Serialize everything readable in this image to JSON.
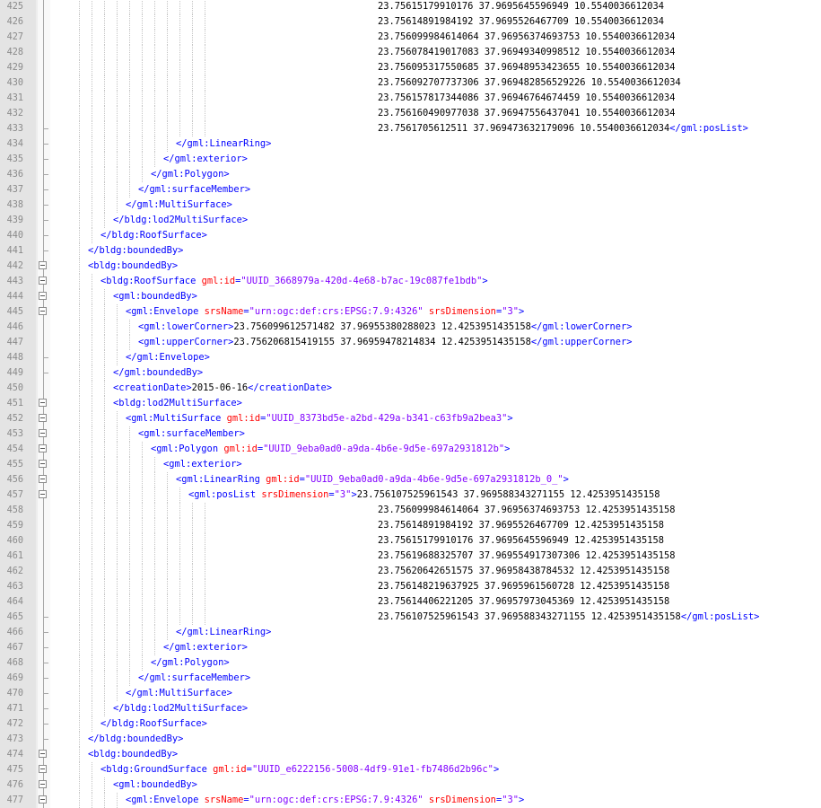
{
  "editor": {
    "colors": {
      "tag": "#0000ff",
      "attribute": "#ff0000",
      "value": "#8000ff",
      "text": "#000000",
      "gutter": "#e4e4e4",
      "line_number": "#8a8a8a"
    },
    "lines": [
      {
        "num": "425",
        "fold": "line",
        "tokens": [
          {
            "t": "text",
            "s": "23.75615179910176 37.9695645596949 10.5540036612034"
          }
        ]
      },
      {
        "num": "426",
        "fold": "line",
        "tokens": [
          {
            "t": "text",
            "s": "23.75614891984192 37.9695526467709 10.5540036612034"
          }
        ]
      },
      {
        "num": "427",
        "fold": "line",
        "tokens": [
          {
            "t": "text",
            "s": "23.756099984614064 37.96956374693753 10.5540036612034"
          }
        ]
      },
      {
        "num": "428",
        "fold": "line",
        "tokens": [
          {
            "t": "text",
            "s": "23.756078419017083 37.96949340998512 10.5540036612034"
          }
        ]
      },
      {
        "num": "429",
        "fold": "line",
        "tokens": [
          {
            "t": "text",
            "s": "23.756095317550685 37.96948953423655 10.5540036612034"
          }
        ]
      },
      {
        "num": "430",
        "fold": "line",
        "tokens": [
          {
            "t": "text",
            "s": "23.756092707737306 37.969482856529226 10.5540036612034"
          }
        ]
      },
      {
        "num": "431",
        "fold": "line",
        "tokens": [
          {
            "t": "text",
            "s": "23.756157817344086 37.96946764674459 10.5540036612034"
          }
        ]
      },
      {
        "num": "432",
        "fold": "line",
        "tokens": [
          {
            "t": "text",
            "s": "23.756160490977038 37.96947556437041 10.5540036612034"
          }
        ]
      },
      {
        "num": "433",
        "fold": "end",
        "tokens": [
          {
            "t": "text",
            "s": "23.7561705612511 37.969473632179096 10.5540036612034"
          },
          {
            "t": "tag",
            "s": "</gml:posList>"
          }
        ]
      },
      {
        "num": "434",
        "fold": "end",
        "tokens": [
          {
            "t": "tag",
            "s": "</gml:LinearRing>"
          }
        ]
      },
      {
        "num": "435",
        "fold": "end",
        "tokens": [
          {
            "t": "tag",
            "s": "</gml:exterior>"
          }
        ]
      },
      {
        "num": "436",
        "fold": "end",
        "tokens": [
          {
            "t": "tag",
            "s": "</gml:Polygon>"
          }
        ]
      },
      {
        "num": "437",
        "fold": "end",
        "tokens": [
          {
            "t": "tag",
            "s": "</gml:surfaceMember>"
          }
        ]
      },
      {
        "num": "438",
        "fold": "end",
        "tokens": [
          {
            "t": "tag",
            "s": "</gml:MultiSurface>"
          }
        ]
      },
      {
        "num": "439",
        "fold": "end",
        "tokens": [
          {
            "t": "tag",
            "s": "</bldg:lod2MultiSurface>"
          }
        ]
      },
      {
        "num": "440",
        "fold": "end",
        "tokens": [
          {
            "t": "tag",
            "s": "</bldg:RoofSurface>"
          }
        ]
      },
      {
        "num": "441",
        "fold": "end",
        "tokens": [
          {
            "t": "tag",
            "s": "</bldg:boundedBy>"
          }
        ]
      },
      {
        "num": "442",
        "fold": "open",
        "tokens": [
          {
            "t": "tag",
            "s": "<bldg:boundedBy>"
          }
        ]
      },
      {
        "num": "443",
        "fold": "open",
        "tokens": [
          {
            "t": "tag",
            "s": "<bldg:RoofSurface "
          },
          {
            "t": "attr",
            "s": "gml:id"
          },
          {
            "t": "tag",
            "s": "="
          },
          {
            "t": "val",
            "s": "\"UUID_3668979a-420d-4e68-b7ac-19c087fe1bdb\""
          },
          {
            "t": "tag",
            "s": ">"
          }
        ]
      },
      {
        "num": "444",
        "fold": "open",
        "tokens": [
          {
            "t": "tag",
            "s": "<gml:boundedBy>"
          }
        ]
      },
      {
        "num": "445",
        "fold": "open",
        "tokens": [
          {
            "t": "tag",
            "s": "<gml:Envelope "
          },
          {
            "t": "attr",
            "s": "srsName"
          },
          {
            "t": "tag",
            "s": "="
          },
          {
            "t": "val",
            "s": "\"urn:ogc:def:crs:EPSG:7.9:4326\""
          },
          {
            "t": "tag",
            "s": " "
          },
          {
            "t": "attr",
            "s": "srsDimension"
          },
          {
            "t": "tag",
            "s": "="
          },
          {
            "t": "val",
            "s": "\"3\""
          },
          {
            "t": "tag",
            "s": ">"
          }
        ]
      },
      {
        "num": "446",
        "fold": "line",
        "tokens": [
          {
            "t": "tag",
            "s": "<gml:lowerCorner>"
          },
          {
            "t": "text",
            "s": "23.756099612571482 37.96955380288023 12.4253951435158"
          },
          {
            "t": "tag",
            "s": "</gml:lowerCorner>"
          }
        ]
      },
      {
        "num": "447",
        "fold": "line",
        "tokens": [
          {
            "t": "tag",
            "s": "<gml:upperCorner>"
          },
          {
            "t": "text",
            "s": "23.756206815419155 37.96959478214834 12.4253951435158"
          },
          {
            "t": "tag",
            "s": "</gml:upperCorner>"
          }
        ]
      },
      {
        "num": "448",
        "fold": "end",
        "tokens": [
          {
            "t": "tag",
            "s": "</gml:Envelope>"
          }
        ]
      },
      {
        "num": "449",
        "fold": "end",
        "tokens": [
          {
            "t": "tag",
            "s": "</gml:boundedBy>"
          }
        ]
      },
      {
        "num": "450",
        "fold": "line",
        "tokens": [
          {
            "t": "tag",
            "s": "<creationDate>"
          },
          {
            "t": "text",
            "s": "2015-06-16"
          },
          {
            "t": "tag",
            "s": "</creationDate>"
          }
        ]
      },
      {
        "num": "451",
        "fold": "open",
        "tokens": [
          {
            "t": "tag",
            "s": "<bldg:lod2MultiSurface>"
          }
        ]
      },
      {
        "num": "452",
        "fold": "open",
        "tokens": [
          {
            "t": "tag",
            "s": "<gml:MultiSurface "
          },
          {
            "t": "attr",
            "s": "gml:id"
          },
          {
            "t": "tag",
            "s": "="
          },
          {
            "t": "val",
            "s": "\"UUID_8373bd5e-a2bd-429a-b341-c63fb9a2bea3\""
          },
          {
            "t": "tag",
            "s": ">"
          }
        ]
      },
      {
        "num": "453",
        "fold": "open",
        "tokens": [
          {
            "t": "tag",
            "s": "<gml:surfaceMember>"
          }
        ]
      },
      {
        "num": "454",
        "fold": "open",
        "tokens": [
          {
            "t": "tag",
            "s": "<gml:Polygon "
          },
          {
            "t": "attr",
            "s": "gml:id"
          },
          {
            "t": "tag",
            "s": "="
          },
          {
            "t": "val",
            "s": "\"UUID_9eba0ad0-a9da-4b6e-9d5e-697a2931812b\""
          },
          {
            "t": "tag",
            "s": ">"
          }
        ]
      },
      {
        "num": "455",
        "fold": "open",
        "tokens": [
          {
            "t": "tag",
            "s": "<gml:exterior>"
          }
        ]
      },
      {
        "num": "456",
        "fold": "open",
        "tokens": [
          {
            "t": "tag",
            "s": "<gml:LinearRing "
          },
          {
            "t": "attr",
            "s": "gml:id"
          },
          {
            "t": "tag",
            "s": "="
          },
          {
            "t": "val",
            "s": "\"UUID_9eba0ad0-a9da-4b6e-9d5e-697a2931812b_0_\""
          },
          {
            "t": "tag",
            "s": ">"
          }
        ]
      },
      {
        "num": "457",
        "fold": "open",
        "tokens": [
          {
            "t": "tag",
            "s": "<gml:posList "
          },
          {
            "t": "attr",
            "s": "srsDimension"
          },
          {
            "t": "tag",
            "s": "="
          },
          {
            "t": "val",
            "s": "\"3\""
          },
          {
            "t": "tag",
            "s": ">"
          },
          {
            "t": "text",
            "s": "23.756107525961543 37.969588343271155 12.4253951435158"
          }
        ]
      },
      {
        "num": "458",
        "fold": "line",
        "tokens": [
          {
            "t": "text",
            "s": "23.756099984614064 37.96956374693753 12.4253951435158"
          }
        ]
      },
      {
        "num": "459",
        "fold": "line",
        "tokens": [
          {
            "t": "text",
            "s": "23.75614891984192 37.9695526467709 12.4253951435158"
          }
        ]
      },
      {
        "num": "460",
        "fold": "line",
        "tokens": [
          {
            "t": "text",
            "s": "23.75615179910176 37.9695645596949 12.4253951435158"
          }
        ]
      },
      {
        "num": "461",
        "fold": "line",
        "tokens": [
          {
            "t": "text",
            "s": "23.75619688325707 37.969554917307306 12.4253951435158"
          }
        ]
      },
      {
        "num": "462",
        "fold": "line",
        "tokens": [
          {
            "t": "text",
            "s": "23.75620642651575 37.96958438784532 12.4253951435158"
          }
        ]
      },
      {
        "num": "463",
        "fold": "line",
        "tokens": [
          {
            "t": "text",
            "s": "23.756148219637925 37.9695961560728 12.4253951435158"
          }
        ]
      },
      {
        "num": "464",
        "fold": "line",
        "tokens": [
          {
            "t": "text",
            "s": "23.75614406221205 37.96957973045369 12.4253951435158"
          }
        ]
      },
      {
        "num": "465",
        "fold": "end",
        "tokens": [
          {
            "t": "text",
            "s": "23.756107525961543 37.969588343271155 12.4253951435158"
          },
          {
            "t": "tag",
            "s": "</gml:posList>"
          }
        ]
      },
      {
        "num": "466",
        "fold": "end",
        "tokens": [
          {
            "t": "tag",
            "s": "</gml:LinearRing>"
          }
        ]
      },
      {
        "num": "467",
        "fold": "end",
        "tokens": [
          {
            "t": "tag",
            "s": "</gml:exterior>"
          }
        ]
      },
      {
        "num": "468",
        "fold": "end",
        "tokens": [
          {
            "t": "tag",
            "s": "</gml:Polygon>"
          }
        ]
      },
      {
        "num": "469",
        "fold": "end",
        "tokens": [
          {
            "t": "tag",
            "s": "</gml:surfaceMember>"
          }
        ]
      },
      {
        "num": "470",
        "fold": "end",
        "tokens": [
          {
            "t": "tag",
            "s": "</gml:MultiSurface>"
          }
        ]
      },
      {
        "num": "471",
        "fold": "end",
        "tokens": [
          {
            "t": "tag",
            "s": "</bldg:lod2MultiSurface>"
          }
        ]
      },
      {
        "num": "472",
        "fold": "end",
        "tokens": [
          {
            "t": "tag",
            "s": "</bldg:RoofSurface>"
          }
        ]
      },
      {
        "num": "473",
        "fold": "end",
        "tokens": [
          {
            "t": "tag",
            "s": "</bldg:boundedBy>"
          }
        ]
      },
      {
        "num": "474",
        "fold": "open",
        "tokens": [
          {
            "t": "tag",
            "s": "<bldg:boundedBy>"
          }
        ]
      },
      {
        "num": "475",
        "fold": "open",
        "tokens": [
          {
            "t": "tag",
            "s": "<bldg:GroundSurface "
          },
          {
            "t": "attr",
            "s": "gml:id"
          },
          {
            "t": "tag",
            "s": "="
          },
          {
            "t": "val",
            "s": "\"UUID_e6222156-5008-4df9-91e1-fb7486d2b96c\""
          },
          {
            "t": "tag",
            "s": ">"
          }
        ]
      },
      {
        "num": "476",
        "fold": "open",
        "tokens": [
          {
            "t": "tag",
            "s": "<gml:boundedBy>"
          }
        ]
      },
      {
        "num": "477",
        "fold": "open",
        "tokens": [
          {
            "t": "tag",
            "s": "<gml:Envelope "
          },
          {
            "t": "attr",
            "s": "srsName"
          },
          {
            "t": "tag",
            "s": "="
          },
          {
            "t": "val",
            "s": "\"urn:ogc:def:crs:EPSG:7.9:4326\""
          },
          {
            "t": "tag",
            "s": " "
          },
          {
            "t": "attr",
            "s": "srsDimension"
          },
          {
            "t": "tag",
            "s": "="
          },
          {
            "t": "val",
            "s": "\"3\""
          },
          {
            "t": "tag",
            "s": ">"
          }
        ]
      }
    ]
  }
}
